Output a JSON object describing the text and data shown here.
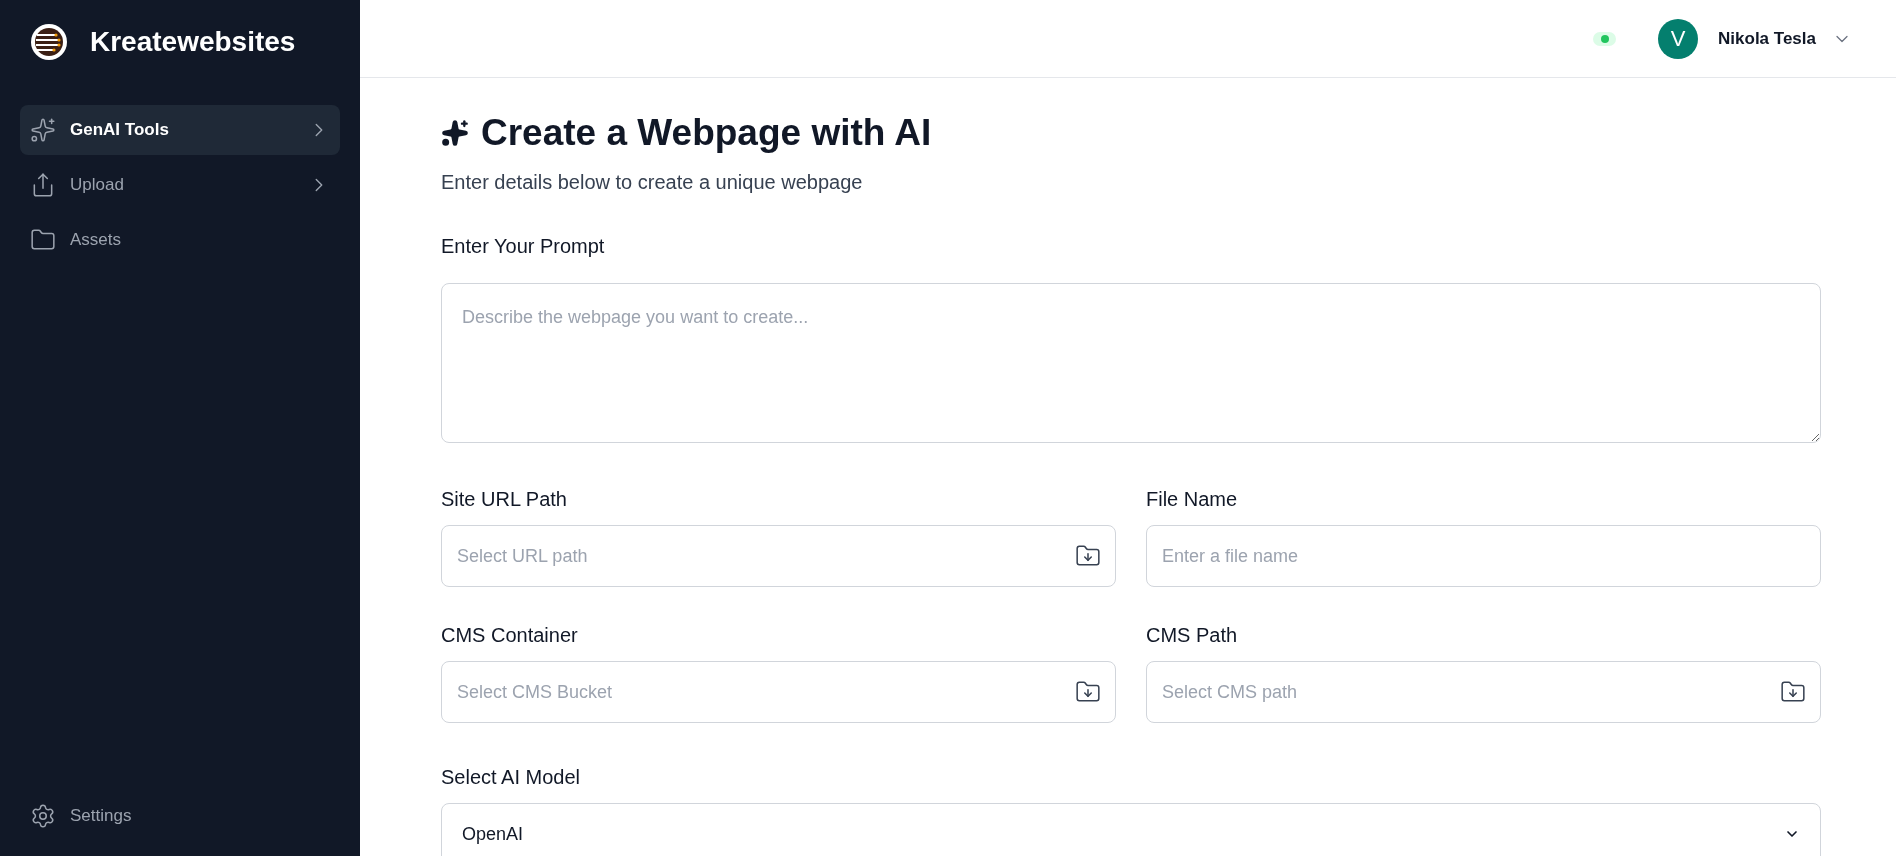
{
  "sidebar": {
    "brand": "Kreatewebsites",
    "items": [
      {
        "label": "GenAI Tools",
        "selected": true,
        "expandable": true
      },
      {
        "label": "Upload",
        "selected": false,
        "expandable": true
      },
      {
        "label": "Assets",
        "selected": false,
        "expandable": false
      }
    ],
    "footer_item": {
      "label": "Settings"
    }
  },
  "header": {
    "status": {
      "color": "#22c55e"
    },
    "user": {
      "initial": "V",
      "name": "Nikola Tesla"
    }
  },
  "main": {
    "title": "Create a Webpage with AI",
    "subtitle": "Enter details below to create a unique webpage",
    "prompt": {
      "label": "Enter Your Prompt",
      "placeholder": "Describe the webpage you want to create..."
    },
    "fields": [
      {
        "label": "Site URL Path",
        "placeholder": "Select URL path",
        "kind": "picker"
      },
      {
        "label": "File Name",
        "placeholder": "Enter a file name",
        "kind": "text"
      },
      {
        "label": "CMS Container",
        "placeholder": "Select CMS Bucket",
        "kind": "picker"
      },
      {
        "label": "CMS Path",
        "placeholder": "Select CMS path",
        "kind": "picker"
      }
    ],
    "model": {
      "label": "Select AI Model",
      "value": "OpenAI"
    }
  }
}
